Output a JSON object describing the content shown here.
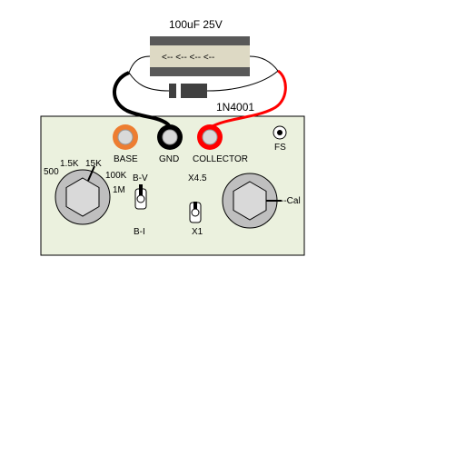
{
  "capacitor": {
    "value_label": "100uF 25V",
    "polarity_marks": "<-- <-- <-- <--"
  },
  "diode": {
    "part_label": "1N4001"
  },
  "terminals": {
    "base": "BASE",
    "gnd": "GND",
    "collector": "COLLECTOR",
    "fs": "FS"
  },
  "range_dial": {
    "labels": [
      "500",
      "1.5K",
      "15K",
      "100K",
      "1M"
    ]
  },
  "mode_switch": {
    "top": "B-V",
    "bottom": "B-I"
  },
  "gain_switch": {
    "top": "X4.5",
    "bottom": "X1"
  },
  "cal_knob": {
    "label": "--Cal"
  },
  "colors": {
    "panel": "#ebf1de",
    "base_terminal": "#ed7d31",
    "gnd_terminal": "#000000",
    "collector_terminal": "#ff0000",
    "collector_wire": "#ff0000",
    "gnd_wire": "#000000",
    "capacitor_band": "#595959",
    "capacitor_body": "#ddd9c4",
    "diode_body": "#404040"
  }
}
